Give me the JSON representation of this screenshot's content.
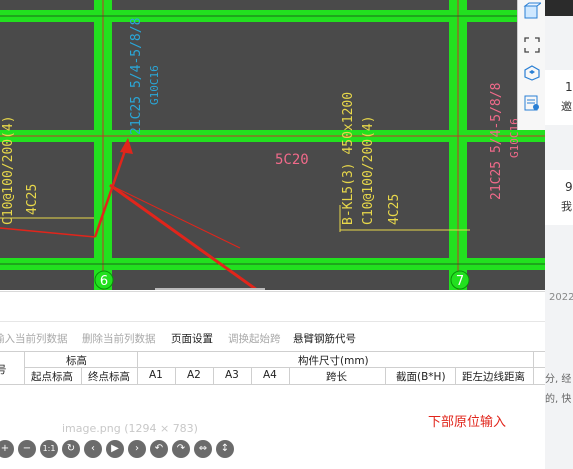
{
  "drawing": {
    "grid_labels": [
      "6",
      "7"
    ],
    "beam_left_text": "21C25 5/4-5/8/8",
    "beam_left_text2": "G10C16",
    "beam_right_vertical": "21C25 5/4-5/8/8",
    "beam_right_vertical2": "G10C16",
    "center_label": "5C20",
    "beam_label_1": "B-KL5(3) 450x1200",
    "beam_label_2": "C10@100/200(4)",
    "beam_label_3": "4C25",
    "left_label_1": "C10@100/200(4)",
    "left_label_2": "4C25"
  },
  "right_panel": {
    "items": [
      "1",
      "邀",
      "9",
      "我",
      "2022",
      "分, 经",
      "的, 快"
    ]
  },
  "toolbar": {
    "items": [
      {
        "label": "输入当前列数据",
        "enabled": false
      },
      {
        "label": "删除当前列数据",
        "enabled": false
      },
      {
        "label": "页面设置",
        "enabled": true
      },
      {
        "label": "调换起始跨",
        "enabled": false
      },
      {
        "label": "悬臂钢筋代号",
        "enabled": true
      }
    ]
  },
  "table": {
    "col_num": "号",
    "group_elevation": "标高",
    "start_elev": "起点标高",
    "end_elev": "终点标高",
    "group_size": "构件尺寸(mm)",
    "a1": "A1",
    "a2": "A2",
    "a3": "A3",
    "a4": "A4",
    "span_len": "跨长",
    "section": "截面(B*H)",
    "left_dist": "距左边线距离"
  },
  "viewer": {
    "filename": "image.png (1294 × 783)",
    "buttons": [
      "+",
      "−",
      "1:1",
      "↻",
      "‹",
      "▶",
      "›",
      "↶",
      "↷",
      "⇔",
      "↕"
    ]
  },
  "annotation": {
    "text": "下部原位输入"
  },
  "colors": {
    "beam_green": "#22e01f",
    "cad_bg": "#4a4a4a",
    "annotation_red": "#e1251b",
    "cyan_text": "#2aa7d8",
    "yellow_text": "#e8d84a",
    "pink_text": "#f06a8a"
  }
}
